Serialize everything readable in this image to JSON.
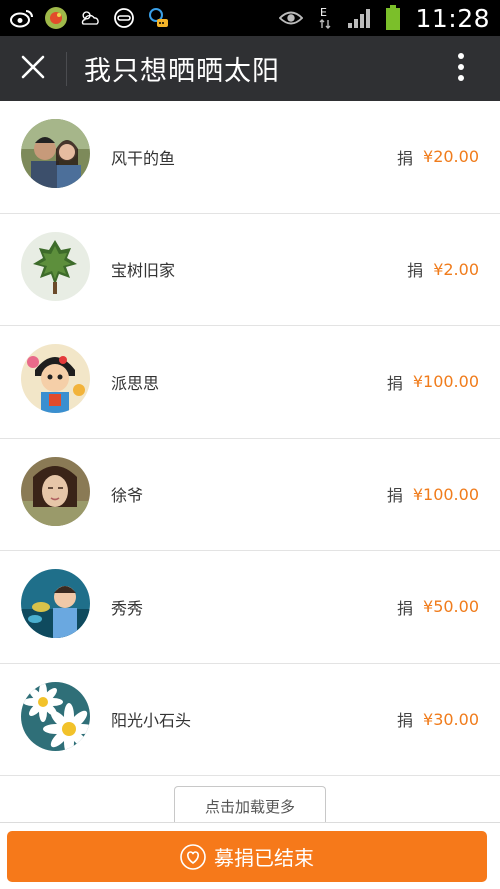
{
  "status_bar": {
    "time": "11:28",
    "network_label": "E",
    "icons": [
      "weibo-icon",
      "game-icon",
      "weather-icon",
      "helmet-icon",
      "qq-chat-icon",
      "eye-icon",
      "network-icon",
      "signal-icon",
      "battery-icon"
    ]
  },
  "header": {
    "title": "我只想晒晒太阳",
    "close_icon": "close-icon",
    "more_icon": "more-vertical-icon",
    "background": "#2f3033"
  },
  "donors": [
    {
      "name": "风干的鱼",
      "label": "捐",
      "amount": "¥20.00"
    },
    {
      "name": "宝树旧家",
      "label": "捐",
      "amount": "¥2.00"
    },
    {
      "name": "派思思",
      "label": "捐",
      "amount": "¥100.00"
    },
    {
      "name": "徐爷",
      "label": "捐",
      "amount": "¥100.00"
    },
    {
      "name": "秀秀",
      "label": "捐",
      "amount": "¥50.00"
    },
    {
      "name": "阳光小石头",
      "label": "捐",
      "amount": "¥30.00"
    }
  ],
  "load_more": "点击加载更多",
  "footer": {
    "button_label": "募捐已结束",
    "icon": "heart-icon",
    "accent_color": "#f6791a",
    "amount_color": "#f07c1c"
  }
}
